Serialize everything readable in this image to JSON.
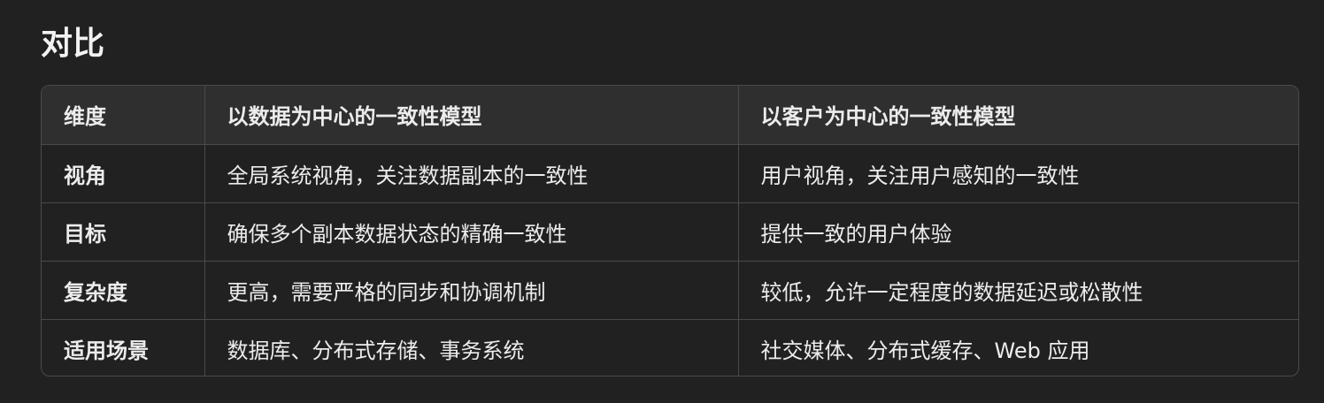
{
  "heading": "对比",
  "table": {
    "headers": [
      "维度",
      "以数据为中心的一致性模型",
      "以客户为中心的一致性模型"
    ],
    "rows": [
      [
        "视角",
        "全局系统视角，关注数据副本的一致性",
        "用户视角，关注用户感知的一致性"
      ],
      [
        "目标",
        "确保多个副本数据状态的精确一致性",
        "提供一致的用户体验"
      ],
      [
        "复杂度",
        "更高，需要严格的同步和协调机制",
        "较低，允许一定程度的数据延迟或松散性"
      ],
      [
        "适用场景",
        "数据库、分布式存储、事务系统",
        "社交媒体、分布式缓存、Web 应用"
      ]
    ]
  }
}
